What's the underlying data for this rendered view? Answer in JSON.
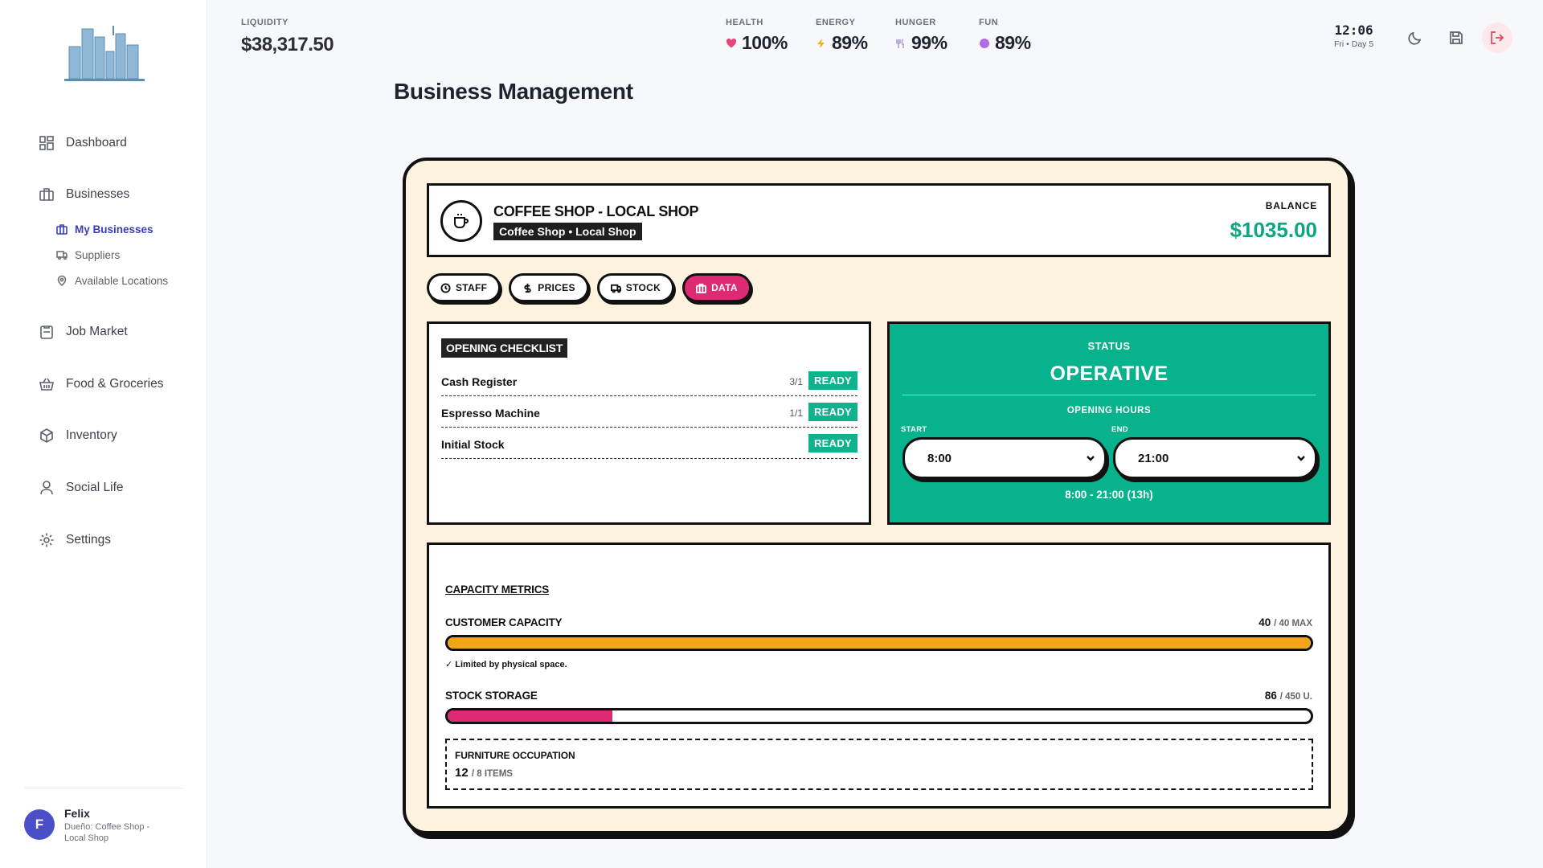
{
  "sidebar": {
    "nav": [
      {
        "label": "Dashboard",
        "icon": "grid-icon"
      },
      {
        "label": "Businesses",
        "icon": "briefcase-icon"
      },
      {
        "label": "Job Market",
        "icon": "clipboard-icon"
      },
      {
        "label": "Food & Groceries",
        "icon": "basket-icon"
      },
      {
        "label": "Inventory",
        "icon": "box-icon"
      },
      {
        "label": "Social Life",
        "icon": "user-icon"
      },
      {
        "label": "Settings",
        "icon": "gear-icon"
      }
    ],
    "sub_items": [
      {
        "label": "My Businesses",
        "icon": "briefcase-icon",
        "active": true
      },
      {
        "label": "Suppliers",
        "icon": "truck-icon"
      },
      {
        "label": "Available Locations",
        "icon": "pin-icon"
      }
    ],
    "user": {
      "initial": "F",
      "name": "Felix",
      "role": "Dueño: Coffee Shop - Local Shop"
    }
  },
  "topbar": {
    "liquidity_label": "LIQUIDITY",
    "liquidity_value": "$38,317.50",
    "stats": [
      {
        "label": "HEALTH",
        "value": "100%",
        "icon": "heart-icon",
        "color": "#e8457a"
      },
      {
        "label": "ENERGY",
        "value": "89%",
        "icon": "bolt-icon",
        "color": "#f2b21c"
      },
      {
        "label": "HUNGER",
        "value": "99%",
        "icon": "utensils-icon",
        "color": "#b9a7d8"
      },
      {
        "label": "FUN",
        "value": "89%",
        "icon": "circle-icon",
        "color": "#b36ce8"
      }
    ],
    "time": "12:06",
    "day": "Fri • Day 5"
  },
  "page_title": "Business Management",
  "business": {
    "title": "COFFEE SHOP - LOCAL SHOP",
    "tag": "Coffee Shop • Local Shop",
    "balance_label": "BALANCE",
    "balance_value": "$1035.00"
  },
  "tabs": [
    {
      "label": "STAFF",
      "icon": "clock-icon"
    },
    {
      "label": "PRICES",
      "icon": "dollar-icon"
    },
    {
      "label": "STOCK",
      "icon": "truck-icon"
    },
    {
      "label": "DATA",
      "icon": "briefcase-icon",
      "active": true
    }
  ],
  "checklist": {
    "title": "OPENING CHECKLIST",
    "items": [
      {
        "name": "Cash Register",
        "count": "3/1",
        "status": "READY"
      },
      {
        "name": "Espresso Machine",
        "count": "1/1",
        "status": "READY"
      },
      {
        "name": "Initial Stock",
        "count": "",
        "status": "READY"
      }
    ]
  },
  "status": {
    "label": "STATUS",
    "value": "OPERATIVE",
    "hours_label": "OPENING HOURS",
    "start_label": "START",
    "end_label": "END",
    "start_value": "8:00",
    "end_value": "21:00",
    "summary": "8:00 - 21:00 (13h)"
  },
  "metrics": {
    "title": "CAPACITY METRICS",
    "customer": {
      "label": "CUSTOMER CAPACITY",
      "value": "40",
      "max": "/ 40 MAX",
      "fraction": 1.0,
      "color": "#f2a516",
      "note": "✓ Limited by physical space."
    },
    "stock": {
      "label": "STOCK STORAGE",
      "value": "86",
      "max": "/ 450 U.",
      "fraction": 0.191,
      "color": "#dd2a73"
    },
    "furniture": {
      "label": "FURNITURE OCCUPATION",
      "value": "12",
      "max": "/ 8 ITEMS"
    }
  }
}
